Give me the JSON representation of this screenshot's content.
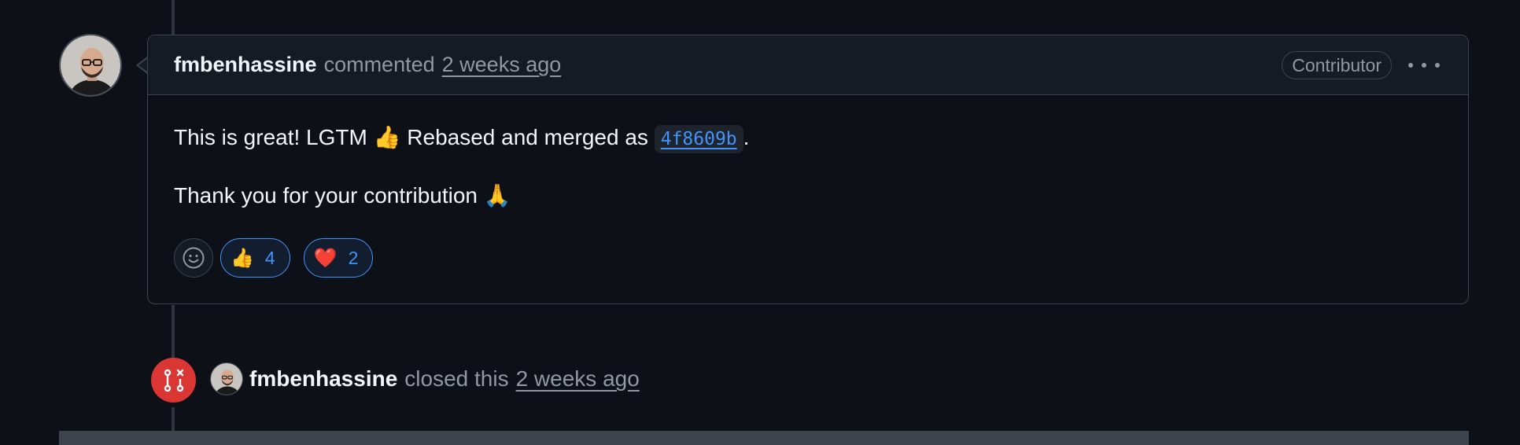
{
  "comment": {
    "author": "fmbenhassine",
    "action": "commented",
    "timestamp": "2 weeks ago",
    "role_badge": "Contributor",
    "body": {
      "line1_before": "This is great! LGTM ",
      "line1_emoji": "👍",
      "line1_middle": " Rebased and merged as ",
      "commit_sha": "4f8609b",
      "line1_after": ".",
      "line2_text": "Thank you for your contribution ",
      "line2_emoji": "🙏"
    },
    "reactions": [
      {
        "emoji": "👍",
        "count": "4"
      },
      {
        "emoji": "❤️",
        "count": "2"
      }
    ]
  },
  "event": {
    "author": "fmbenhassine",
    "action": "closed this",
    "timestamp": "2 weeks ago",
    "icon": "pr-closed-icon"
  },
  "colors": {
    "background": "#0d1117",
    "accent_blue": "#4493f8",
    "closed_red": "#da3633",
    "muted_text": "#9198a1"
  }
}
